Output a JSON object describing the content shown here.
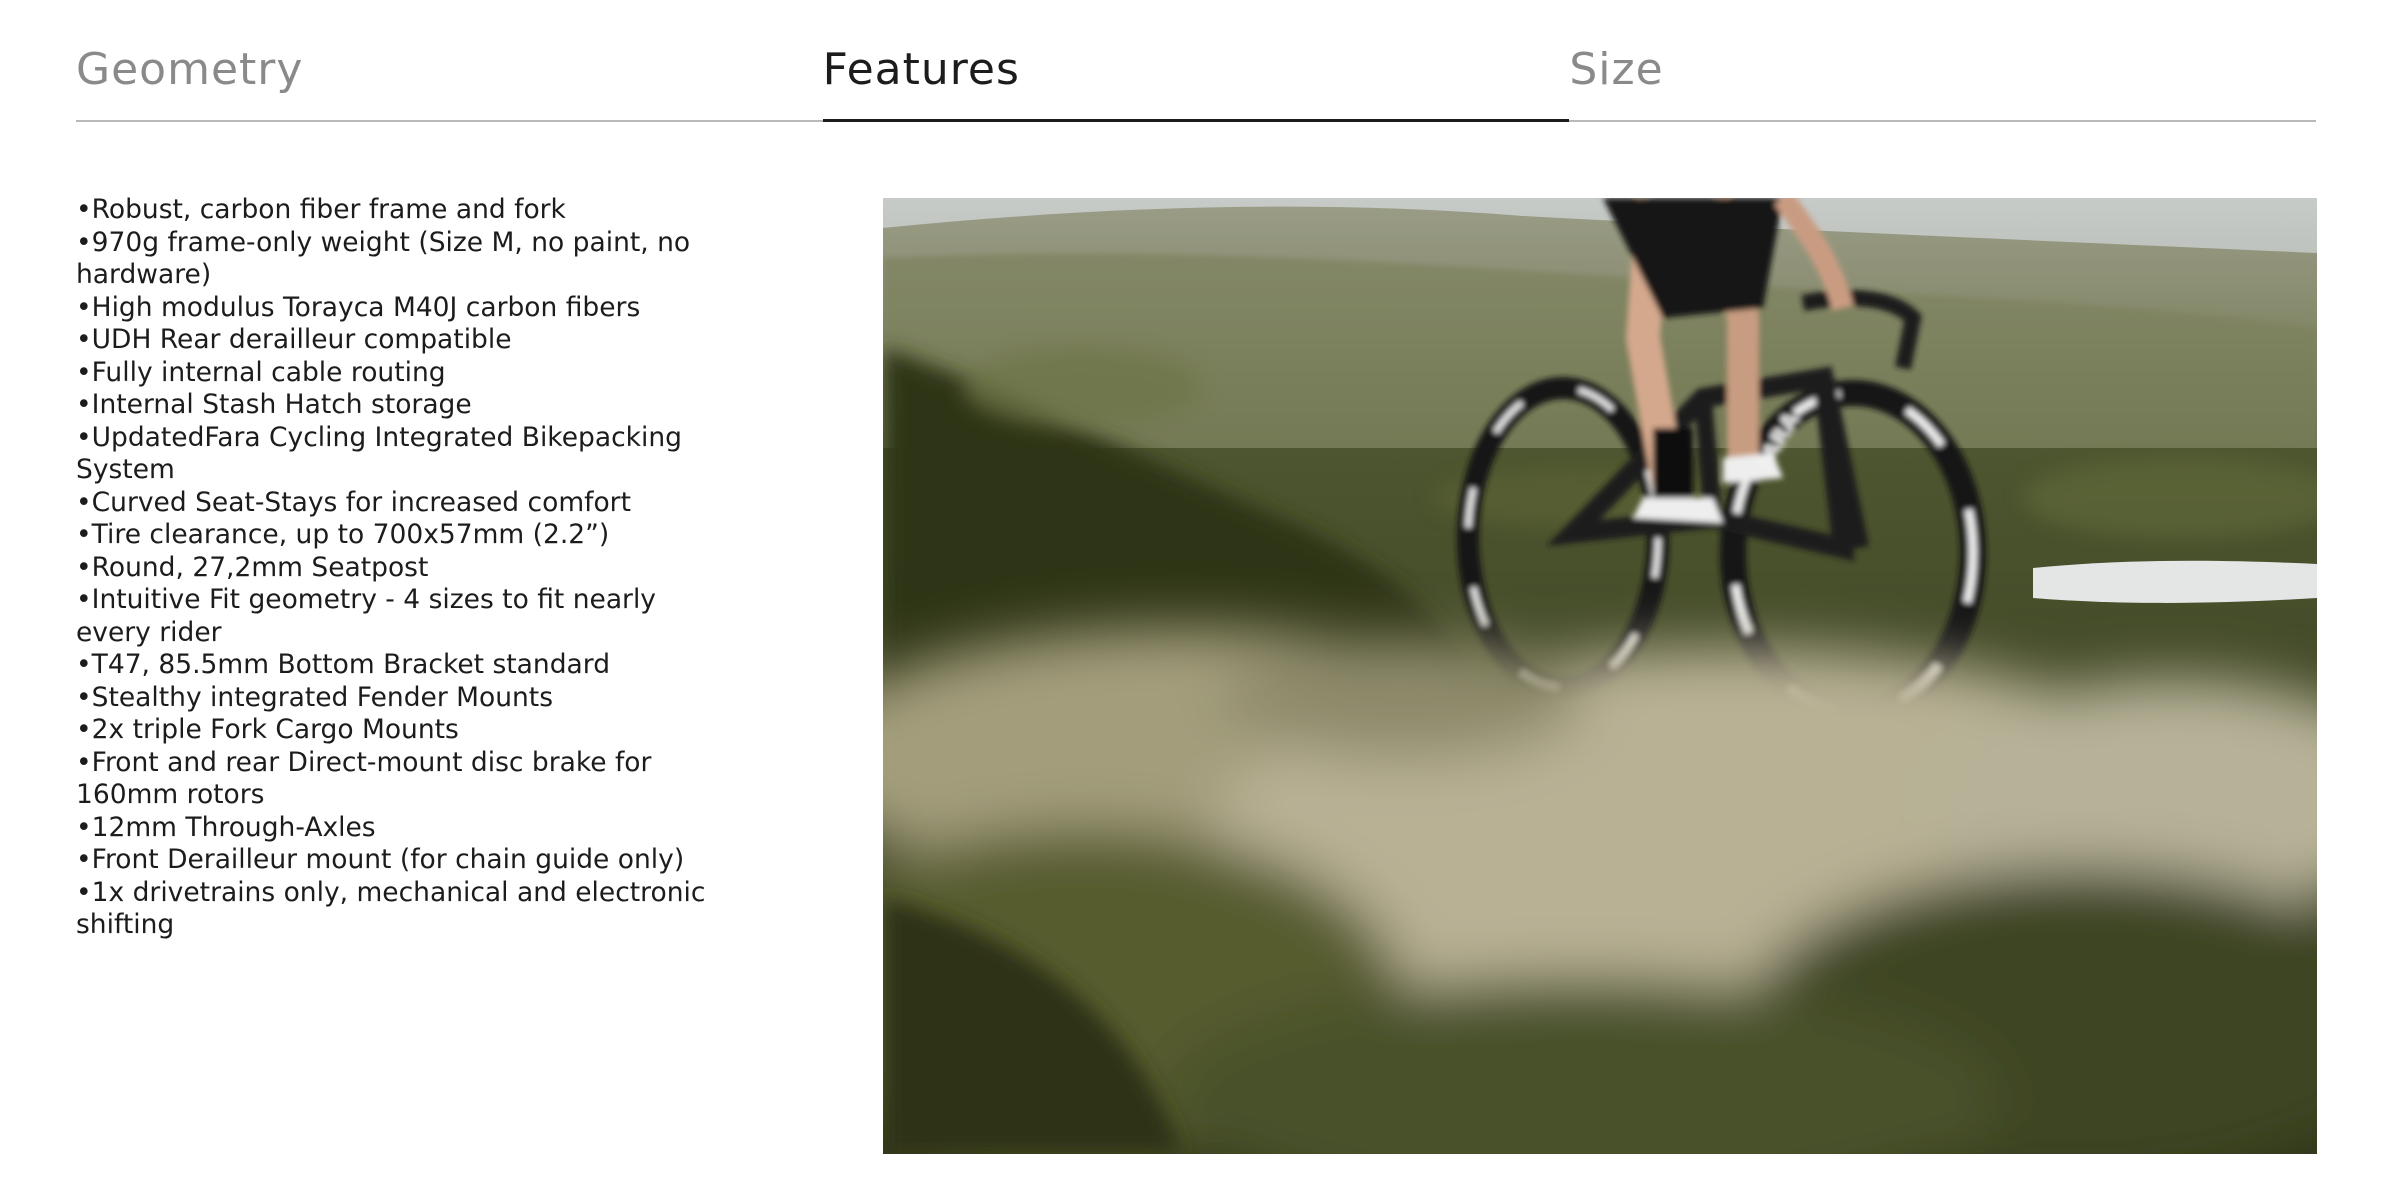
{
  "tabs": [
    {
      "label": "Geometry",
      "active": false
    },
    {
      "label": "Features",
      "active": true
    },
    {
      "label": "Size",
      "active": false
    }
  ],
  "features": [
    "Robust, carbon fiber frame and fork",
    "970g frame-only weight (Size M, no paint, no hardware)",
    "High modulus Torayca M40J carbon fibers",
    "UDH Rear derailleur compatible",
    "Fully internal cable routing",
    "Internal Stash Hatch storage",
    "UpdatedFara Cycling Integrated Bikepacking System",
    "Curved Seat-Stays for increased comfort",
    "Tire clearance, up to 700x57mm (2.2”)",
    "Round, 27,2mm Seatpost",
    "Intuitive Fit geometry - 4 sizes to fit nearly every rider",
    "T47, 85.5mm Bottom Bracket standard",
    "Stealthy integrated Fender Mounts",
    "2x triple Fork Cargo Mounts",
    "Front and rear Direct-mount disc brake for 160mm rotors",
    "12mm Through-Axles",
    "Front Derailleur mount (for chain guide only)",
    "1x drivetrains only, mechanical and electronic shifting"
  ],
  "photo": {
    "frame_text": "FARA",
    "colors": {
      "sky": "#cfd2cf",
      "hills": "#8e9276",
      "moss": "#5a5f37",
      "bike": "#1a1a1a",
      "foreground": "#b3ab8c"
    }
  }
}
